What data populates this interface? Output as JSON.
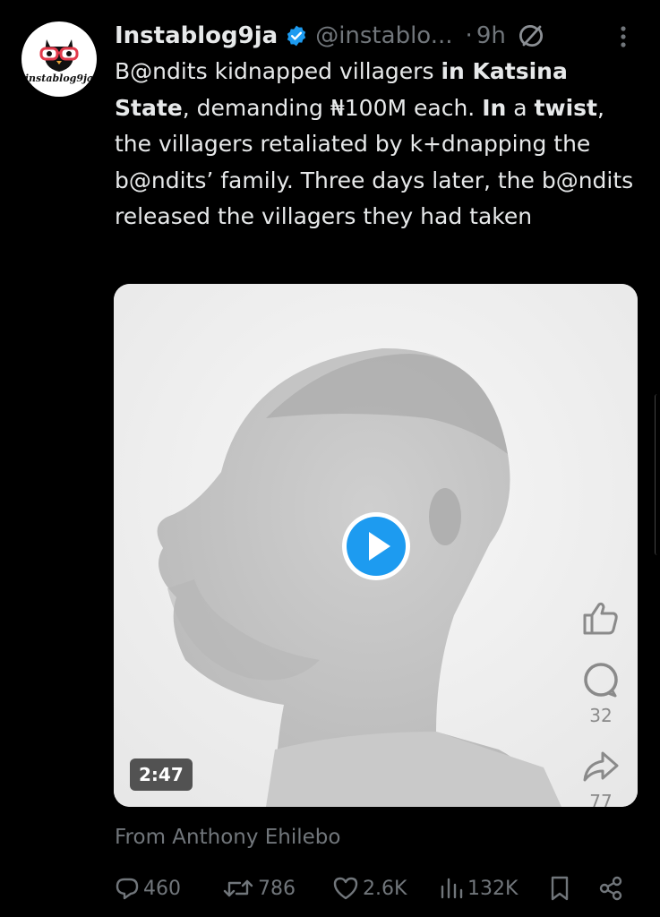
{
  "post": {
    "author_name": "Instablog9ja",
    "handle": "@instablo...",
    "dot": "·",
    "time": "9h",
    "avatar_text": "instablog9ja",
    "text_segments": [
      {
        "text": "B@ndits kidnapped villagers ",
        "bold": false
      },
      {
        "text": "in Katsina State",
        "bold": true
      },
      {
        "text": ", demanding ₦100M each. ",
        "bold": false
      },
      {
        "text": "In",
        "bold": true
      },
      {
        "text": " a ",
        "bold": false
      },
      {
        "text": "twist",
        "bold": true
      },
      {
        "text": ", the villagers retaliated by k+dnapping the b@ndits’ family. Three days later, the b@ndits released the villagers they had taken",
        "bold": false
      }
    ]
  },
  "media": {
    "duration": "2:47",
    "overlay": {
      "comment_count": "32",
      "share_count": "77"
    }
  },
  "attribution": "From Anthony Ehilebo",
  "actions": {
    "replies": "460",
    "reposts": "786",
    "likes": "2.6K",
    "views": "132K"
  },
  "colors": {
    "background": "#000000",
    "text": "#e7e9ea",
    "muted": "#71767b",
    "verified": "#1d9bf0",
    "play": "#1d9bf0"
  },
  "icons": [
    "verified-badge-icon",
    "grok-icon",
    "more-icon",
    "play-icon",
    "thumbs-up-icon",
    "comment-bubble-icon",
    "share-arrow-icon",
    "reply-icon",
    "repost-icon",
    "like-icon",
    "views-icon",
    "bookmark-icon",
    "share-icon"
  ]
}
